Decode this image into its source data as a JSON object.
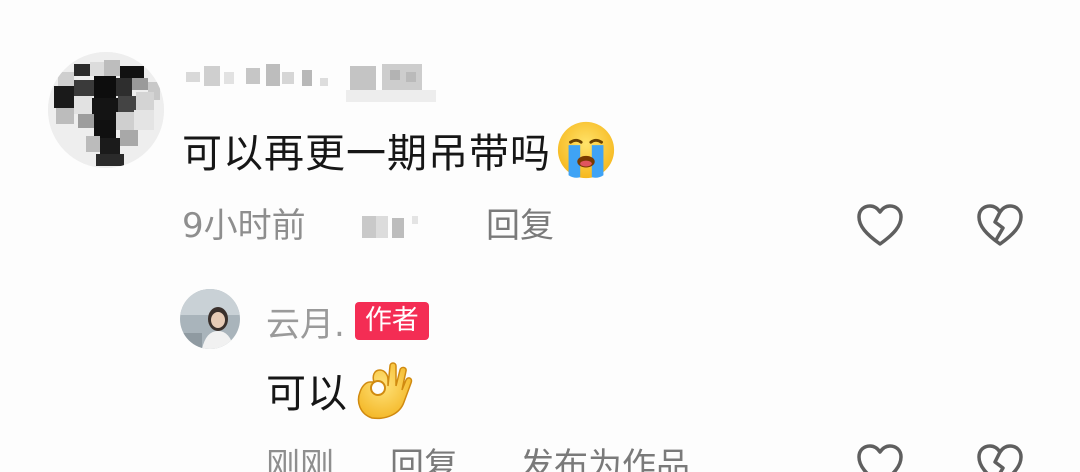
{
  "comment": {
    "username": "",
    "text": "可以再更一期吊带吗",
    "emoji": "loudly-crying-face",
    "time": "9小时前",
    "reply_label": "回复",
    "like_icon": "heart-outline-icon",
    "dislike_icon": "broken-heart-icon"
  },
  "reply": {
    "username": "云月.",
    "badge": "作者",
    "text": "可以",
    "emoji": "ok-hand",
    "time": "刚刚",
    "reply_label": "回复",
    "publish_label": "发布为作品",
    "like_icon": "heart-outline-icon",
    "dislike_icon": "broken-heart-icon"
  },
  "colors": {
    "badge_bg": "#f42d54",
    "meta_text": "#8e8e8e",
    "comment_text": "#161616",
    "icon_stroke": "#5f5f5f"
  }
}
